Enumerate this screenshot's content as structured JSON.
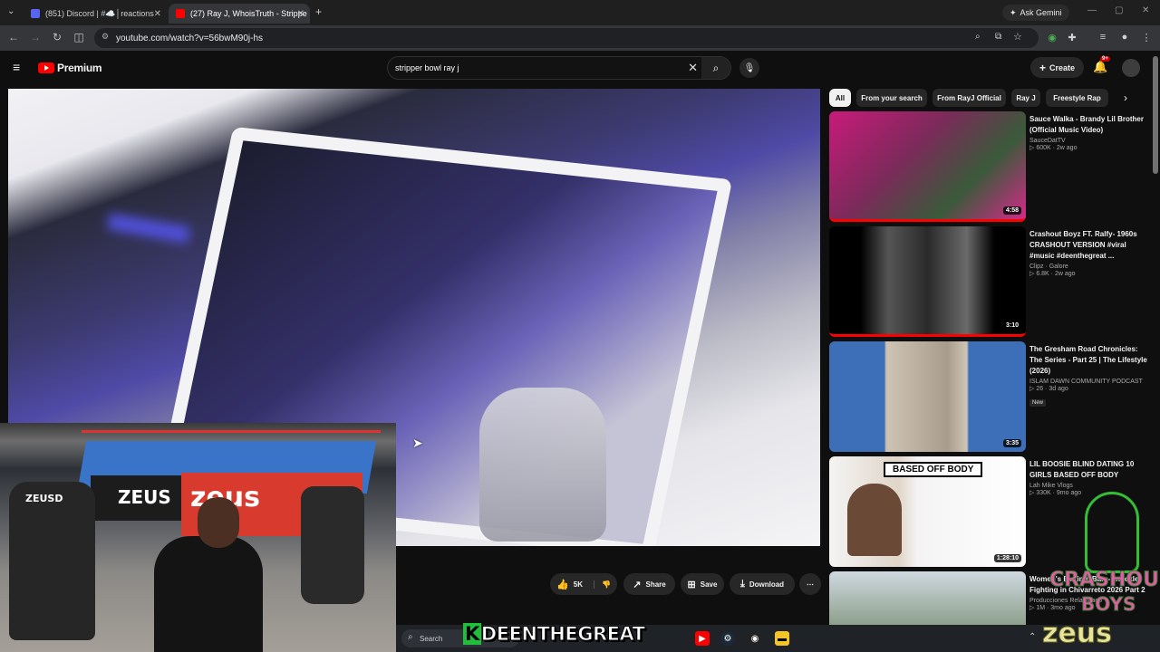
{
  "browser": {
    "tabs": [
      {
        "label": "(851) Discord | #☁️│reactions",
        "active": false
      },
      {
        "label": "(27) Ray J, WhoisTruth - Strippe",
        "active": true
      }
    ],
    "ask_gemini": "Ask Gemini",
    "url": "youtube.com/watch?v=56bwM90j-hs"
  },
  "youtube": {
    "logo_text": "Premium",
    "search_query": "stripper bowl ray j",
    "create_label": "Create",
    "notification_count": "9+"
  },
  "video_actions": {
    "like_count": "5K",
    "share_label": "Share",
    "save_label": "Save",
    "download_label": "Download"
  },
  "chips": [
    "All",
    "From your search",
    "From RayJ Official",
    "Ray J",
    "Freestyle Rap"
  ],
  "recommendations": [
    {
      "title": "Sauce Walka - Brandy Lil Brother (Official Music Video)",
      "channel": "SauceDatTV",
      "stats": "▷ 600K · 2w ago",
      "duration": "4:58",
      "badge": ""
    },
    {
      "title": "Crashout Boyz FT. Ralfy- 1960s CRASHOUT VERSION #viral #music #deenthegreat ...",
      "channel": "Clipz · Galore",
      "stats": "▷ 6.8K · 2w ago",
      "duration": "3:10",
      "badge": ""
    },
    {
      "title": "The Gresham Road Chronicles: The Series - Part 25 | The Lifestyle (2026)",
      "channel": "ISLAM DAWN COMMUNITY PODCAST",
      "stats": "▷ 26 · 3d ago",
      "duration": "3:35",
      "badge": "New"
    },
    {
      "title": "LIL BOOSIE BLIND DATING 10 GIRLS BASED OFF BODY",
      "channel": "Lah Mike Vlogs",
      "stats": "▷ 330K · 9mo ago",
      "duration": "1:28:10",
      "badge": "",
      "thumb_text": "BASED OFF BODY"
    },
    {
      "title": "Women's Boxing, Bare-Knuckle Fighting in Chivarreto 2026 Part 2",
      "channel": "Producciones Relampago",
      "stats": "▷ 1M · 3mo ago",
      "duration": "",
      "badge": ""
    }
  ],
  "taskbar": {
    "search_label": "Search"
  },
  "overlay": {
    "watermark": "DEENTHEGREAT",
    "watermark_k": "K",
    "crashout": "CRASHOU",
    "boys": "BOYS",
    "zeus": "zeus",
    "apron_left": "ZEUS",
    "apron_right": "zeus",
    "chair_brand": "ZEUSD"
  },
  "colors": {
    "accent": "#ff0000",
    "watermark_green": "#1fbf3c",
    "overlay_pink": "#e65aa8"
  }
}
